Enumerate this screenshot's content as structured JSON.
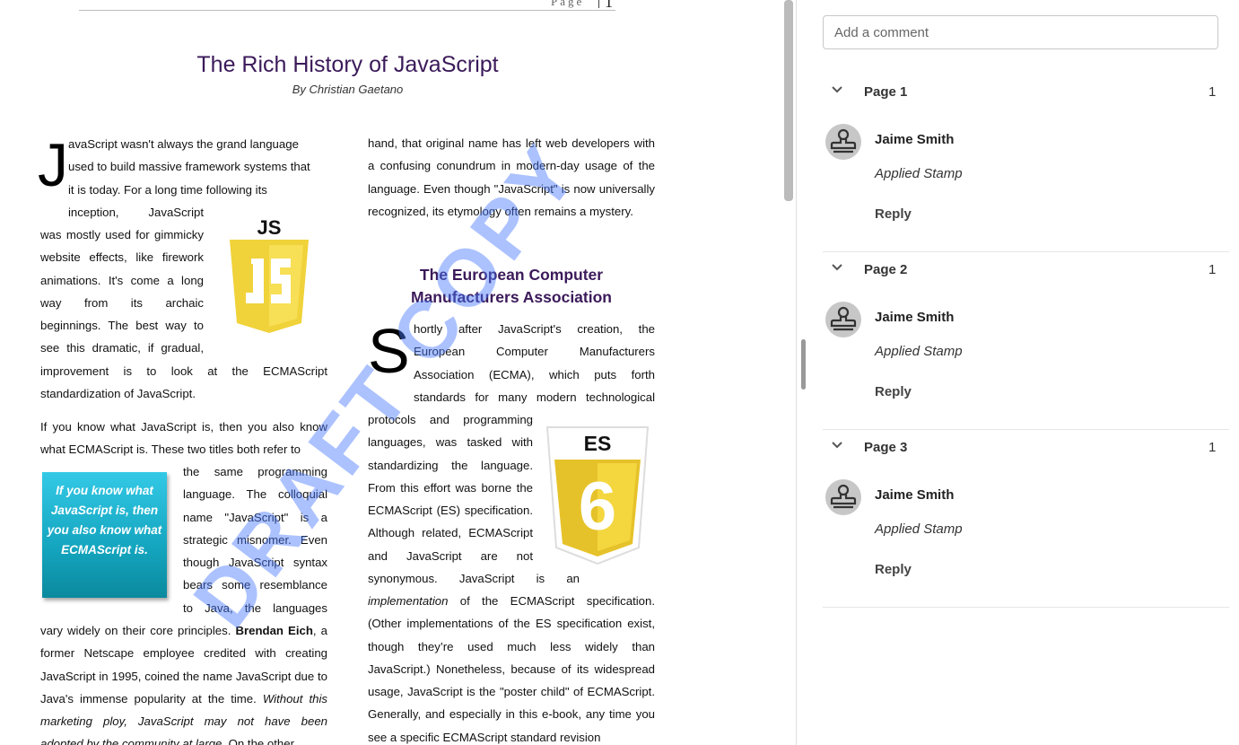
{
  "document": {
    "header": {
      "label": "Page",
      "number": "1"
    },
    "title": "The Rich History of JavaScript",
    "byline": "By Christian Gaetano",
    "col1": {
      "dropcap": "J",
      "intro_lines": [
        "avaScript wasn't always the grand language",
        "used to build massive framework systems that",
        "it is today. For a long time following its",
        "inception, JavaScript"
      ],
      "wrap_lines": [
        "was mostly used for gimmicky",
        "website effects, like firework",
        "animations. It's come a long",
        "way from its archaic",
        "beginnings. The best way to",
        "see this dramatic, if gradual,"
      ],
      "para1_end": "improvement is to look at the ECMAScript standardization of JavaScript.",
      "para2_start": "If you know what JavaScript is, then you also know what ECMAScript is. These two titles both refer to",
      "wrap2_lines": [
        "the same programming",
        "language. The colloquial",
        "name \"JavaScript\" is a",
        "strategic misnomer. Even",
        "though JavaScript syntax",
        "bears some resemblance",
        "to Java, the languages"
      ],
      "para2_pre_bold": "vary widely on their core principles. ",
      "para2_bold": "Brendan Eich",
      "para2_post_bold": ", a former Netscape employee credited with creating JavaScript in 1995, coined the name JavaScript due to Java's immense popularity at the time. ",
      "para2_italic": "Without this marketing ploy, JavaScript may not have been adopted by the community at large.",
      "para2_tail": " On the other",
      "pull_quote": "If you know what JavaScript is, then you also know what ECMAScript is.",
      "js_badge": "JS"
    },
    "col2": {
      "para1": "hand, that original name has left web developers with a confusing conundrum in modern-day usage of the language. Even though \"JavaScript\" is now universally recognized, its etymology often remains a mystery.",
      "section_title": "The European Computer Manufacturers Association",
      "dropcap": "S",
      "intro_lines": [
        "hortly after JavaScript's creation, the",
        "European Computer Manufacturers",
        "Association (ECMA), which puts forth",
        "standards for many modern technological"
      ],
      "wrap_lines": [
        "protocols and programming",
        "languages, was tasked with",
        "standardizing the language.",
        "From this effort was borne the",
        "ECMAScript (ES) specification.",
        "Although related, ECMAScript",
        "and JavaScript are not",
        "synonymous. JavaScript is an"
      ],
      "after_italic": "implementation",
      "after_rest": " of the ECMAScript specification. (Other implementations of the ES specification exist, though they’re used much less widely than JavaScript.) Nonetheless, because of its widespread usage, JavaScript is the \"poster child\" of ECMAScript. Generally, and especially in this e-book, any time you see a specific ECMAScript standard revision",
      "es_badge": "ES",
      "es_number": "6"
    },
    "watermark": "DRAFT COPY"
  },
  "comments_panel": {
    "input_placeholder": "Add a comment",
    "groups": [
      {
        "page_label": "Page 1",
        "count": "1",
        "author": "Jaime Smith",
        "text": "Applied Stamp",
        "reply_label": "Reply"
      },
      {
        "page_label": "Page 2",
        "count": "1",
        "author": "Jaime Smith",
        "text": "Applied Stamp",
        "reply_label": "Reply"
      },
      {
        "page_label": "Page 3",
        "count": "1",
        "author": "Jaime Smith",
        "text": "Applied Stamp",
        "reply_label": "Reply"
      }
    ],
    "icons": {
      "collapse": "chevron-down-icon",
      "avatar": "stamp-icon"
    }
  },
  "colors": {
    "title": "#3b1a5a",
    "watermark": "#4678ff",
    "pull_quote": "#14a5bf",
    "badge": "#f0d23a"
  }
}
